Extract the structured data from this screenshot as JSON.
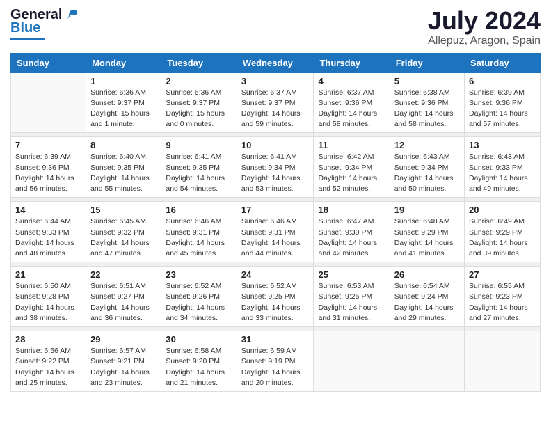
{
  "header": {
    "logo_general": "General",
    "logo_blue": "Blue",
    "month": "July 2024",
    "location": "Allepuz, Aragon, Spain"
  },
  "weekdays": [
    "Sunday",
    "Monday",
    "Tuesday",
    "Wednesday",
    "Thursday",
    "Friday",
    "Saturday"
  ],
  "weeks": [
    [
      {
        "day": "",
        "info": ""
      },
      {
        "day": "1",
        "info": "Sunrise: 6:36 AM\nSunset: 9:37 PM\nDaylight: 15 hours\nand 1 minute."
      },
      {
        "day": "2",
        "info": "Sunrise: 6:36 AM\nSunset: 9:37 PM\nDaylight: 15 hours\nand 0 minutes."
      },
      {
        "day": "3",
        "info": "Sunrise: 6:37 AM\nSunset: 9:37 PM\nDaylight: 14 hours\nand 59 minutes."
      },
      {
        "day": "4",
        "info": "Sunrise: 6:37 AM\nSunset: 9:36 PM\nDaylight: 14 hours\nand 58 minutes."
      },
      {
        "day": "5",
        "info": "Sunrise: 6:38 AM\nSunset: 9:36 PM\nDaylight: 14 hours\nand 58 minutes."
      },
      {
        "day": "6",
        "info": "Sunrise: 6:39 AM\nSunset: 9:36 PM\nDaylight: 14 hours\nand 57 minutes."
      }
    ],
    [
      {
        "day": "7",
        "info": "Sunrise: 6:39 AM\nSunset: 9:36 PM\nDaylight: 14 hours\nand 56 minutes."
      },
      {
        "day": "8",
        "info": "Sunrise: 6:40 AM\nSunset: 9:35 PM\nDaylight: 14 hours\nand 55 minutes."
      },
      {
        "day": "9",
        "info": "Sunrise: 6:41 AM\nSunset: 9:35 PM\nDaylight: 14 hours\nand 54 minutes."
      },
      {
        "day": "10",
        "info": "Sunrise: 6:41 AM\nSunset: 9:34 PM\nDaylight: 14 hours\nand 53 minutes."
      },
      {
        "day": "11",
        "info": "Sunrise: 6:42 AM\nSunset: 9:34 PM\nDaylight: 14 hours\nand 52 minutes."
      },
      {
        "day": "12",
        "info": "Sunrise: 6:43 AM\nSunset: 9:34 PM\nDaylight: 14 hours\nand 50 minutes."
      },
      {
        "day": "13",
        "info": "Sunrise: 6:43 AM\nSunset: 9:33 PM\nDaylight: 14 hours\nand 49 minutes."
      }
    ],
    [
      {
        "day": "14",
        "info": "Sunrise: 6:44 AM\nSunset: 9:33 PM\nDaylight: 14 hours\nand 48 minutes."
      },
      {
        "day": "15",
        "info": "Sunrise: 6:45 AM\nSunset: 9:32 PM\nDaylight: 14 hours\nand 47 minutes."
      },
      {
        "day": "16",
        "info": "Sunrise: 6:46 AM\nSunset: 9:31 PM\nDaylight: 14 hours\nand 45 minutes."
      },
      {
        "day": "17",
        "info": "Sunrise: 6:46 AM\nSunset: 9:31 PM\nDaylight: 14 hours\nand 44 minutes."
      },
      {
        "day": "18",
        "info": "Sunrise: 6:47 AM\nSunset: 9:30 PM\nDaylight: 14 hours\nand 42 minutes."
      },
      {
        "day": "19",
        "info": "Sunrise: 6:48 AM\nSunset: 9:29 PM\nDaylight: 14 hours\nand 41 minutes."
      },
      {
        "day": "20",
        "info": "Sunrise: 6:49 AM\nSunset: 9:29 PM\nDaylight: 14 hours\nand 39 minutes."
      }
    ],
    [
      {
        "day": "21",
        "info": "Sunrise: 6:50 AM\nSunset: 9:28 PM\nDaylight: 14 hours\nand 38 minutes."
      },
      {
        "day": "22",
        "info": "Sunrise: 6:51 AM\nSunset: 9:27 PM\nDaylight: 14 hours\nand 36 minutes."
      },
      {
        "day": "23",
        "info": "Sunrise: 6:52 AM\nSunset: 9:26 PM\nDaylight: 14 hours\nand 34 minutes."
      },
      {
        "day": "24",
        "info": "Sunrise: 6:52 AM\nSunset: 9:25 PM\nDaylight: 14 hours\nand 33 minutes."
      },
      {
        "day": "25",
        "info": "Sunrise: 6:53 AM\nSunset: 9:25 PM\nDaylight: 14 hours\nand 31 minutes."
      },
      {
        "day": "26",
        "info": "Sunrise: 6:54 AM\nSunset: 9:24 PM\nDaylight: 14 hours\nand 29 minutes."
      },
      {
        "day": "27",
        "info": "Sunrise: 6:55 AM\nSunset: 9:23 PM\nDaylight: 14 hours\nand 27 minutes."
      }
    ],
    [
      {
        "day": "28",
        "info": "Sunrise: 6:56 AM\nSunset: 9:22 PM\nDaylight: 14 hours\nand 25 minutes."
      },
      {
        "day": "29",
        "info": "Sunrise: 6:57 AM\nSunset: 9:21 PM\nDaylight: 14 hours\nand 23 minutes."
      },
      {
        "day": "30",
        "info": "Sunrise: 6:58 AM\nSunset: 9:20 PM\nDaylight: 14 hours\nand 21 minutes."
      },
      {
        "day": "31",
        "info": "Sunrise: 6:59 AM\nSunset: 9:19 PM\nDaylight: 14 hours\nand 20 minutes."
      },
      {
        "day": "",
        "info": ""
      },
      {
        "day": "",
        "info": ""
      },
      {
        "day": "",
        "info": ""
      }
    ]
  ]
}
